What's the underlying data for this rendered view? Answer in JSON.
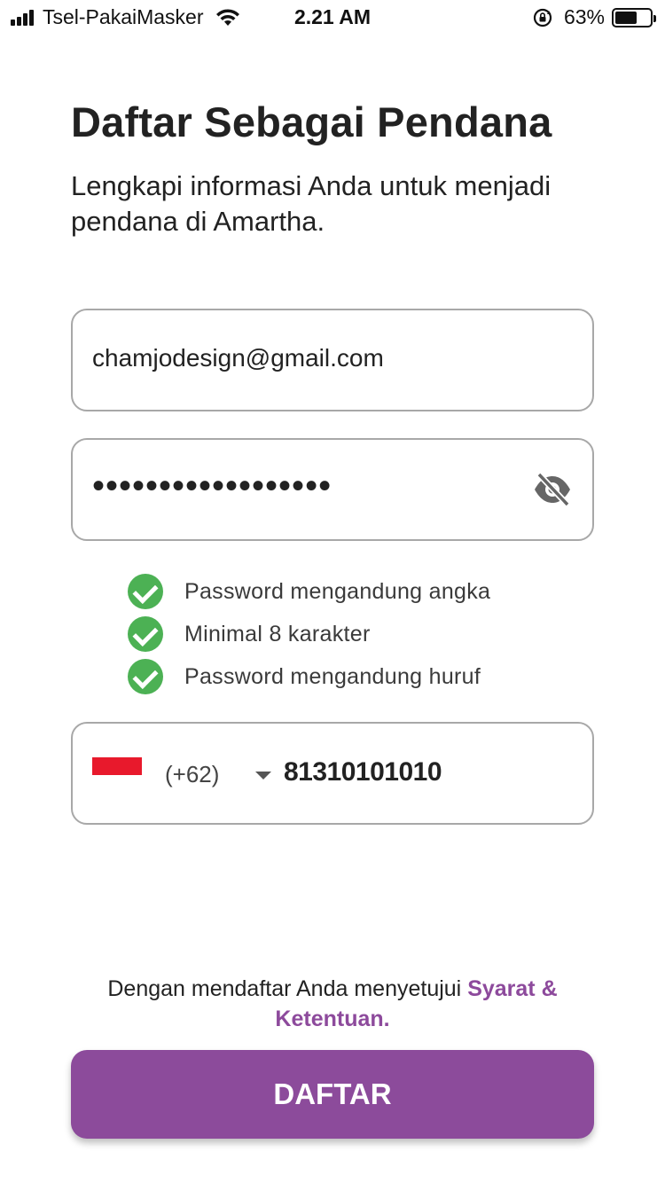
{
  "status_bar": {
    "carrier": "Tsel-PakaiMasker",
    "time": "2.21 AM",
    "battery_percent": "63%",
    "battery_level": 0.63,
    "icons": [
      "signal-icon",
      "wifi-icon",
      "rotation-lock-icon",
      "battery-icon"
    ]
  },
  "header": {
    "title": "Daftar Sebagai Pendana",
    "subtitle": "Lengkapi informasi Anda untuk menjadi pendana di Amartha."
  },
  "form": {
    "email": {
      "value": "chamjodesign@gmail.com"
    },
    "password": {
      "masked_value": "••••••••••••••••••",
      "toggle_icon": "eye-off-icon"
    },
    "password_rules": [
      {
        "label": "Password mengandung angka",
        "satisfied": true
      },
      {
        "label": "Minimal 8 karakter",
        "satisfied": true
      },
      {
        "label": "Password mengandung huruf",
        "satisfied": true
      }
    ],
    "phone": {
      "flag_icon": "indonesia-flag-icon",
      "country_code": "(+62)",
      "number": "81310101010"
    }
  },
  "terms": {
    "prefix": "Dengan mendaftar Anda menyetujui ",
    "link": "Syarat & Ketentuan."
  },
  "submit": {
    "label": "DAFTAR"
  },
  "colors": {
    "accent": "#8c4b9b",
    "check_green": "#4cb154",
    "flag_red": "#e8192c",
    "border": "#a8a8a8"
  }
}
